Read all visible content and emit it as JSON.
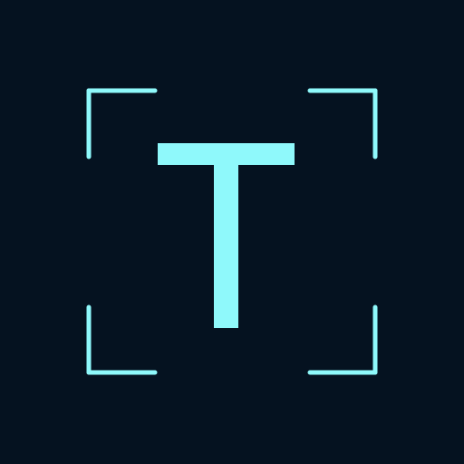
{
  "app": {
    "name": "text-recognition-icon",
    "glyph_letter": "T"
  },
  "colors": {
    "background": "#051220",
    "accent": "#8ff9fb"
  },
  "icons": {
    "glyph": "letter-t-icon",
    "frame": "scan-frame-icon"
  }
}
